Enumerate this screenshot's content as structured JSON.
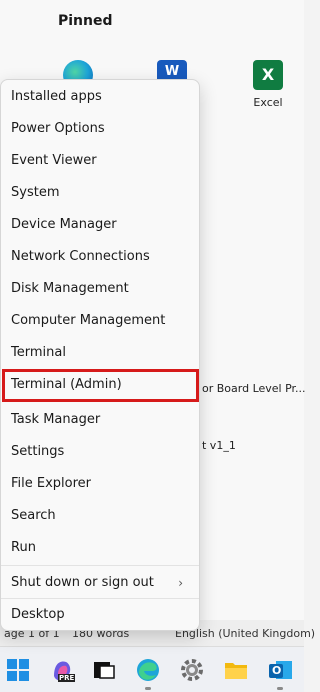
{
  "start_menu": {
    "pinned_title": "Pinned",
    "apps": [
      {
        "label": "",
        "icon": "edge-icon"
      },
      {
        "label": "W",
        "icon": "word-icon"
      },
      {
        "label": "Excel",
        "icon": "excel-icon",
        "tile": "X"
      }
    ],
    "partial_texts": [
      "or Board Level Pr...",
      "t v1_1"
    ]
  },
  "status_bar": {
    "page": "age 1 of 1",
    "words": "180 words",
    "language": "English (United Kingdom)"
  },
  "context_menu": {
    "items": [
      "Installed apps",
      "Power Options",
      "Event Viewer",
      "System",
      "Device Manager",
      "Network Connections",
      "Disk Management",
      "Computer Management",
      "Terminal",
      "Terminal (Admin)",
      "Task Manager",
      "Settings",
      "File Explorer",
      "Search",
      "Run",
      "Shut down or sign out",
      "Desktop"
    ],
    "highlighted_item": "Terminal (Admin)",
    "highlight_color": "#d61a1a",
    "submenu_chevron": "›"
  },
  "taskbar": {
    "icons": [
      "windows-start-icon",
      "copilot-icon",
      "task-view-icon",
      "edge-icon",
      "settings-gear-icon",
      "file-explorer-icon",
      "outlook-icon"
    ],
    "copilot_badge": "PRE",
    "outlook_label": "O"
  }
}
